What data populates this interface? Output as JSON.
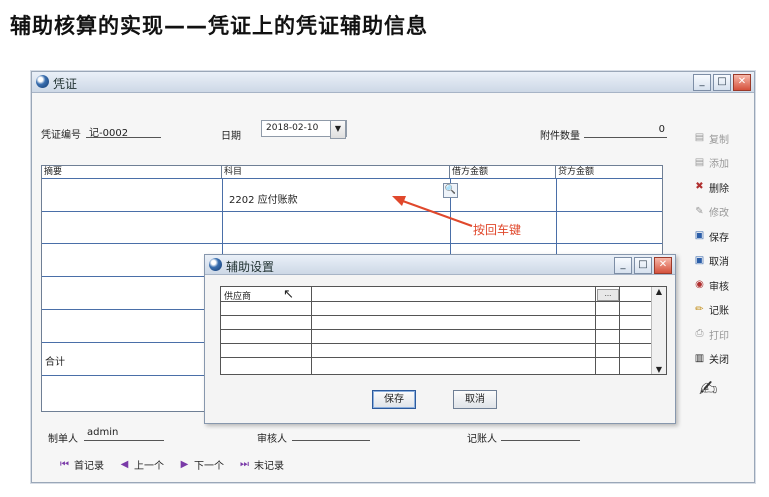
{
  "slide": {
    "title": "辅助核算的实现——凭证上的凭证辅助信息"
  },
  "voucher_window": {
    "title": "凭证",
    "buttons": {
      "minimize": "_",
      "maximize": "□",
      "close": "✕"
    },
    "voucher_no_label": "凭证编号",
    "voucher_no": "记-0002",
    "date_label": "日期",
    "date": "2018-02-10",
    "attach_label": "附件数量",
    "attach_count": "0",
    "columns": [
      "摘要",
      "科目",
      "借方金额",
      "贷方金额"
    ],
    "row1_subject": "2202 应付账款",
    "total_label": "合计",
    "preparer_label": "制单人",
    "preparer": "admin",
    "reviewer_label": "审核人",
    "poster_label": "记账人",
    "side_buttons": [
      {
        "label": "复制",
        "icon": "copy-icon",
        "enabled": false
      },
      {
        "label": "添加",
        "icon": "add-icon",
        "enabled": false
      },
      {
        "label": "删除",
        "icon": "delete-icon",
        "enabled": true
      },
      {
        "label": "修改",
        "icon": "edit-icon",
        "enabled": false
      },
      {
        "label": "保存",
        "icon": "save-icon",
        "enabled": true
      },
      {
        "label": "取消",
        "icon": "cancel-icon",
        "enabled": true
      },
      {
        "label": "审核",
        "icon": "audit-icon",
        "enabled": true
      },
      {
        "label": "记账",
        "icon": "post-icon",
        "enabled": true
      },
      {
        "label": "打印",
        "icon": "print-icon",
        "enabled": false
      },
      {
        "label": "关闭",
        "icon": "close-icon",
        "enabled": true
      }
    ],
    "nav": [
      "首记录",
      "上一个",
      "下一个",
      "末记录"
    ]
  },
  "annotation": "按回车键",
  "aux_dialog": {
    "title": "辅助设置",
    "first_cell": "供应商",
    "ellipsis": "...",
    "save": "保存",
    "cancel": "取消"
  },
  "colors": {
    "annotation": "#e0482c",
    "grid_line": "#4a6fa8"
  }
}
